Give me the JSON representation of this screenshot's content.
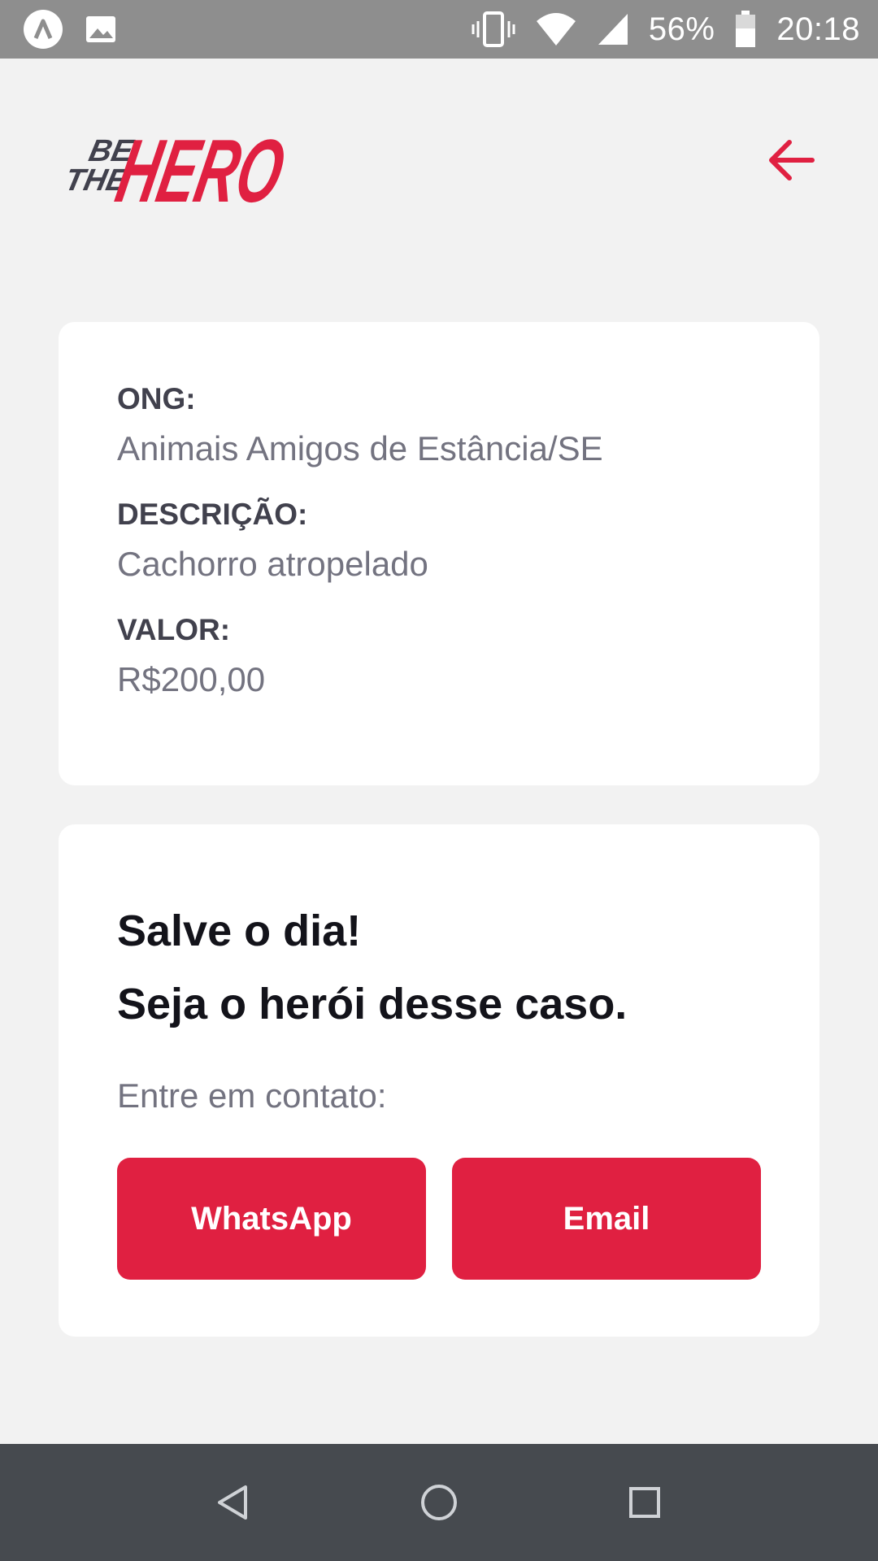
{
  "status_bar": {
    "battery": "56%",
    "time": "20:18"
  },
  "header": {
    "logo_text_small_1": "BE",
    "logo_text_small_2": "THE",
    "logo_text_big": "HERO",
    "back_icon": "arrow-left-icon"
  },
  "incident": {
    "ong_label": "ONG:",
    "ong_value": "Animais Amigos de Estância/SE",
    "description_label": "DESCRIÇÃO:",
    "description_value": "Cachorro atropelado",
    "value_label": "VALOR:",
    "value_value": "R$200,00"
  },
  "contact": {
    "title_line_1": "Salve o dia!",
    "title_line_2": "Seja o herói desse caso.",
    "description": "Entre em contato:",
    "whatsapp_label": "WhatsApp",
    "email_label": "Email"
  },
  "colors": {
    "accent": "#e02041",
    "background": "#f2f2f2",
    "card": "#ffffff",
    "label": "#41414d",
    "value": "#737380",
    "title": "#13131a"
  }
}
